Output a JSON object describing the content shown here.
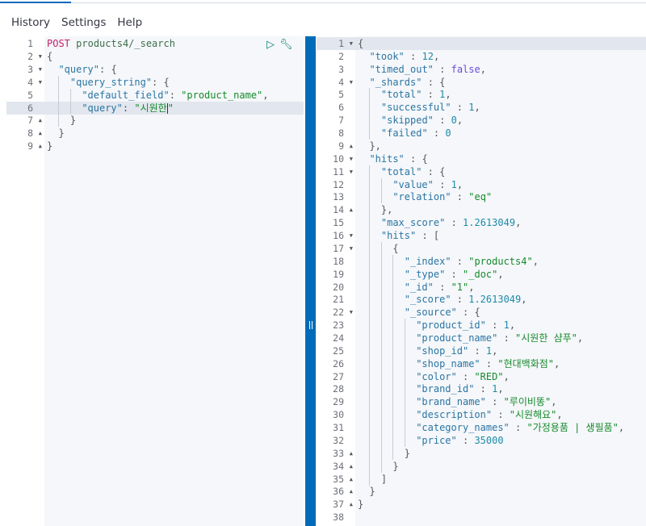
{
  "menu": {
    "history": "History",
    "settings": "Settings",
    "help": "Help"
  },
  "icons": {
    "run": "play-icon",
    "settings": "wrench-icon"
  },
  "request": [
    {
      "n": "1",
      "i": 0,
      "tk": [
        [
          "m",
          "POST"
        ],
        [
          "p",
          " "
        ],
        [
          "u",
          "products4/_search"
        ]
      ]
    },
    {
      "n": "2",
      "f": "open",
      "i": 0,
      "tk": [
        [
          "p",
          "{"
        ]
      ]
    },
    {
      "n": "3",
      "f": "open",
      "i": 1,
      "tk": [
        [
          "k",
          "\"query\""
        ],
        [
          "p",
          ": {"
        ]
      ]
    },
    {
      "n": "4",
      "f": "open",
      "i": 2,
      "tk": [
        [
          "k",
          "\"query_string\""
        ],
        [
          "p",
          ": {"
        ]
      ]
    },
    {
      "n": "5",
      "i": 3,
      "tk": [
        [
          "k",
          "\"default_field\""
        ],
        [
          "p",
          ": "
        ],
        [
          "s",
          "\"product_name\""
        ],
        [
          "p",
          ","
        ]
      ]
    },
    {
      "n": "6",
      "i": 3,
      "hl": true,
      "tk": [
        [
          "k",
          "\"query\""
        ],
        [
          "p",
          ": "
        ],
        [
          "s",
          "\"시원한"
        ],
        [
          "c",
          ""
        ],
        [
          "s",
          "\""
        ]
      ]
    },
    {
      "n": "7",
      "f": "close",
      "i": 2,
      "tk": [
        [
          "p",
          "}"
        ]
      ]
    },
    {
      "n": "8",
      "f": "close",
      "i": 1,
      "tk": [
        [
          "p",
          "}"
        ]
      ]
    },
    {
      "n": "9",
      "f": "close",
      "i": 0,
      "tk": [
        [
          "p",
          "}"
        ]
      ]
    }
  ],
  "response": [
    {
      "n": "1",
      "f": "open",
      "i": 0,
      "hl": true,
      "tk": [
        [
          "p",
          "{"
        ]
      ]
    },
    {
      "n": "2",
      "i": 1,
      "tk": [
        [
          "k",
          "\"took\""
        ],
        [
          "p",
          " : "
        ],
        [
          "n",
          "12"
        ],
        [
          "p",
          ","
        ]
      ]
    },
    {
      "n": "3",
      "i": 1,
      "tk": [
        [
          "k",
          "\"timed_out\""
        ],
        [
          "p",
          " : "
        ],
        [
          "b",
          "false"
        ],
        [
          "p",
          ","
        ]
      ]
    },
    {
      "n": "4",
      "f": "open",
      "i": 1,
      "tk": [
        [
          "k",
          "\"_shards\""
        ],
        [
          "p",
          " : {"
        ]
      ]
    },
    {
      "n": "5",
      "i": 2,
      "tk": [
        [
          "k",
          "\"total\""
        ],
        [
          "p",
          " : "
        ],
        [
          "n",
          "1"
        ],
        [
          "p",
          ","
        ]
      ]
    },
    {
      "n": "6",
      "i": 2,
      "tk": [
        [
          "k",
          "\"successful\""
        ],
        [
          "p",
          " : "
        ],
        [
          "n",
          "1"
        ],
        [
          "p",
          ","
        ]
      ]
    },
    {
      "n": "7",
      "i": 2,
      "tk": [
        [
          "k",
          "\"skipped\""
        ],
        [
          "p",
          " : "
        ],
        [
          "n",
          "0"
        ],
        [
          "p",
          ","
        ]
      ]
    },
    {
      "n": "8",
      "i": 2,
      "tk": [
        [
          "k",
          "\"failed\""
        ],
        [
          "p",
          " : "
        ],
        [
          "n",
          "0"
        ]
      ]
    },
    {
      "n": "9",
      "f": "close",
      "i": 1,
      "tk": [
        [
          "p",
          "},"
        ]
      ]
    },
    {
      "n": "10",
      "f": "open",
      "i": 1,
      "tk": [
        [
          "k",
          "\"hits\""
        ],
        [
          "p",
          " : {"
        ]
      ]
    },
    {
      "n": "11",
      "f": "open",
      "i": 2,
      "tk": [
        [
          "k",
          "\"total\""
        ],
        [
          "p",
          " : {"
        ]
      ]
    },
    {
      "n": "12",
      "i": 3,
      "tk": [
        [
          "k",
          "\"value\""
        ],
        [
          "p",
          " : "
        ],
        [
          "n",
          "1"
        ],
        [
          "p",
          ","
        ]
      ]
    },
    {
      "n": "13",
      "i": 3,
      "tk": [
        [
          "k",
          "\"relation\""
        ],
        [
          "p",
          " : "
        ],
        [
          "s",
          "\"eq\""
        ]
      ]
    },
    {
      "n": "14",
      "f": "close",
      "i": 2,
      "tk": [
        [
          "p",
          "},"
        ]
      ]
    },
    {
      "n": "15",
      "i": 2,
      "tk": [
        [
          "k",
          "\"max_score\""
        ],
        [
          "p",
          " : "
        ],
        [
          "n",
          "1.2613049"
        ],
        [
          "p",
          ","
        ]
      ]
    },
    {
      "n": "16",
      "f": "open",
      "i": 2,
      "tk": [
        [
          "k",
          "\"hits\""
        ],
        [
          "p",
          " : ["
        ]
      ]
    },
    {
      "n": "17",
      "f": "open",
      "i": 3,
      "tk": [
        [
          "p",
          "{"
        ]
      ]
    },
    {
      "n": "18",
      "i": 4,
      "tk": [
        [
          "k",
          "\"_index\""
        ],
        [
          "p",
          " : "
        ],
        [
          "s",
          "\"products4\""
        ],
        [
          "p",
          ","
        ]
      ]
    },
    {
      "n": "19",
      "i": 4,
      "tk": [
        [
          "k",
          "\"_type\""
        ],
        [
          "p",
          " : "
        ],
        [
          "s",
          "\"_doc\""
        ],
        [
          "p",
          ","
        ]
      ]
    },
    {
      "n": "20",
      "i": 4,
      "tk": [
        [
          "k",
          "\"_id\""
        ],
        [
          "p",
          " : "
        ],
        [
          "s",
          "\"1\""
        ],
        [
          "p",
          ","
        ]
      ]
    },
    {
      "n": "21",
      "i": 4,
      "tk": [
        [
          "k",
          "\"_score\""
        ],
        [
          "p",
          " : "
        ],
        [
          "n",
          "1.2613049"
        ],
        [
          "p",
          ","
        ]
      ]
    },
    {
      "n": "22",
      "f": "open",
      "i": 4,
      "tk": [
        [
          "k",
          "\"_source\""
        ],
        [
          "p",
          " : {"
        ]
      ]
    },
    {
      "n": "23",
      "i": 5,
      "tk": [
        [
          "k",
          "\"product_id\""
        ],
        [
          "p",
          " : "
        ],
        [
          "n",
          "1"
        ],
        [
          "p",
          ","
        ]
      ]
    },
    {
      "n": "24",
      "i": 5,
      "tk": [
        [
          "k",
          "\"product_name\""
        ],
        [
          "p",
          " : "
        ],
        [
          "s",
          "\"시원한 샴푸\""
        ],
        [
          "p",
          ","
        ]
      ]
    },
    {
      "n": "25",
      "i": 5,
      "tk": [
        [
          "k",
          "\"shop_id\""
        ],
        [
          "p",
          " : "
        ],
        [
          "n",
          "1"
        ],
        [
          "p",
          ","
        ]
      ]
    },
    {
      "n": "26",
      "i": 5,
      "tk": [
        [
          "k",
          "\"shop_name\""
        ],
        [
          "p",
          " : "
        ],
        [
          "s",
          "\"현대백화점\""
        ],
        [
          "p",
          ","
        ]
      ]
    },
    {
      "n": "27",
      "i": 5,
      "tk": [
        [
          "k",
          "\"color\""
        ],
        [
          "p",
          " : "
        ],
        [
          "s",
          "\"RED\""
        ],
        [
          "p",
          ","
        ]
      ]
    },
    {
      "n": "28",
      "i": 5,
      "tk": [
        [
          "k",
          "\"brand_id\""
        ],
        [
          "p",
          " : "
        ],
        [
          "n",
          "1"
        ],
        [
          "p",
          ","
        ]
      ]
    },
    {
      "n": "29",
      "i": 5,
      "tk": [
        [
          "k",
          "\"brand_name\""
        ],
        [
          "p",
          " : "
        ],
        [
          "s",
          "\"루이비똥\""
        ],
        [
          "p",
          ","
        ]
      ]
    },
    {
      "n": "30",
      "i": 5,
      "tk": [
        [
          "k",
          "\"description\""
        ],
        [
          "p",
          " : "
        ],
        [
          "s",
          "\"시원해요\""
        ],
        [
          "p",
          ","
        ]
      ]
    },
    {
      "n": "31",
      "i": 5,
      "tk": [
        [
          "k",
          "\"category_names\""
        ],
        [
          "p",
          " : "
        ],
        [
          "s",
          "\"가정용품 | 생필품\""
        ],
        [
          "p",
          ","
        ]
      ]
    },
    {
      "n": "32",
      "i": 5,
      "tk": [
        [
          "k",
          "\"price\""
        ],
        [
          "p",
          " : "
        ],
        [
          "n",
          "35000"
        ]
      ]
    },
    {
      "n": "33",
      "f": "close",
      "i": 4,
      "tk": [
        [
          "p",
          "}"
        ]
      ]
    },
    {
      "n": "34",
      "f": "close",
      "i": 3,
      "tk": [
        [
          "p",
          "}"
        ]
      ]
    },
    {
      "n": "35",
      "f": "close",
      "i": 2,
      "tk": [
        [
          "p",
          "]"
        ]
      ]
    },
    {
      "n": "36",
      "f": "close",
      "i": 1,
      "tk": [
        [
          "p",
          "}"
        ]
      ]
    },
    {
      "n": "37",
      "f": "close",
      "i": 0,
      "tk": [
        [
          "p",
          "}"
        ]
      ]
    },
    {
      "n": "38",
      "i": 0,
      "tk": []
    }
  ]
}
